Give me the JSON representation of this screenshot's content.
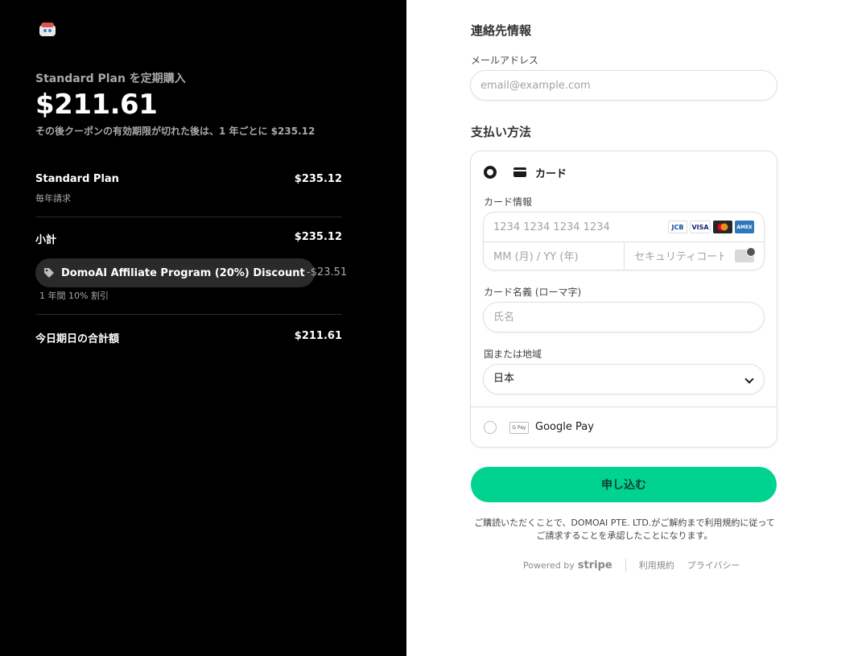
{
  "summary": {
    "plan_title": "Standard Plan を定期購入",
    "price": "$211.61",
    "price_after": "その後クーポンの有効期限が切れた後は、1 年ごとに $235.12",
    "items": [
      {
        "name": "Standard Plan",
        "amount": "$235.12",
        "sub": "毎年請求"
      }
    ],
    "subtotal_label": "小計",
    "subtotal_amount": "$235.12",
    "coupon_label": "DomoAI Affiliate Program (20%) Discount",
    "coupon_amount": "-$23.51",
    "coupon_sub": "1 年間 10% 割引",
    "total_label": "今日期日の合計額",
    "total_amount": "$211.61"
  },
  "contact": {
    "title": "連絡先情報",
    "email_label": "メールアドレス",
    "email_placeholder": "email@example.com"
  },
  "payment": {
    "title": "支払い方法",
    "card_option": "カード",
    "card_info_label": "カード情報",
    "card_number_placeholder": "1234 1234 1234 1234",
    "expiry_placeholder": "MM (月) / YY (年)",
    "cvc_placeholder": "セキュリティコード",
    "brands": [
      "JCB",
      "VISA",
      "MC",
      "AMEX"
    ],
    "name_label": "カード名義 (ローマ字)",
    "name_placeholder": "氏名",
    "country_label": "国または地域",
    "country_value": "日本",
    "gpay_icon_text": "G Pay",
    "gpay_option": "Google Pay"
  },
  "submit_label": "申し込む",
  "terms": "ご購読いただくことで、DOMOAI PTE. LTD.がご解約まで利用規約に従ってご請求することを承認したことになります。",
  "footer": {
    "powered_by": "Powered by",
    "stripe": "stripe",
    "terms_link": "利用規約",
    "privacy_link": "プライバシー"
  }
}
